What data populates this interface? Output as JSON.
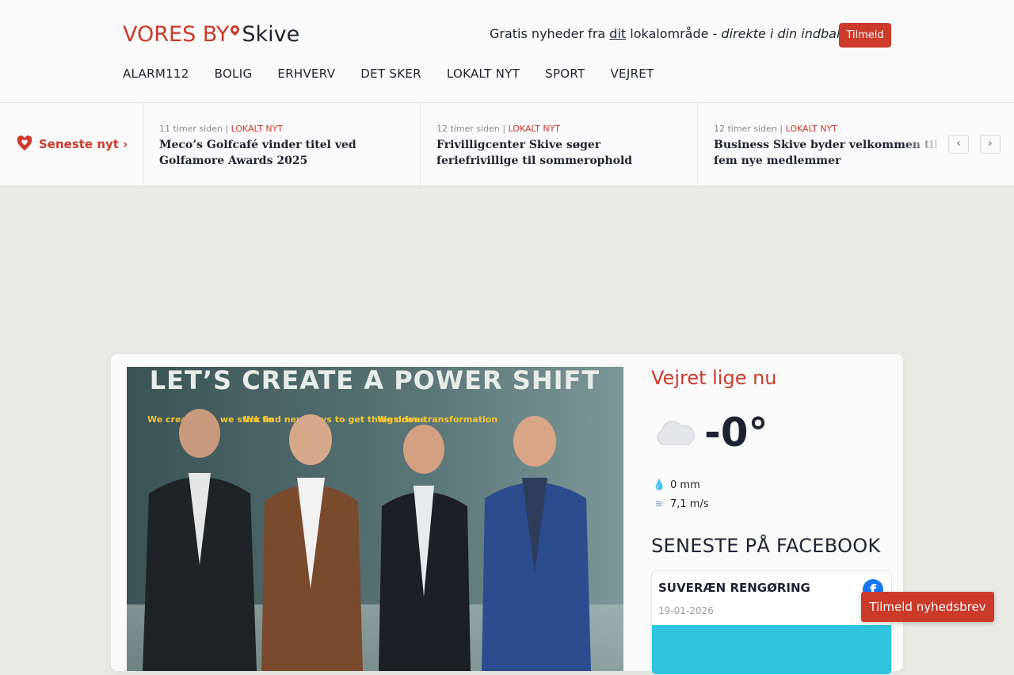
{
  "header": {
    "brand": "VORES BY",
    "city": "Skive",
    "tagline_prefix": "Gratis nyheder fra ",
    "tagline_dit": "dit",
    "tagline_mid": " lokalområde - ",
    "tagline_italic": "direkte i din indbakke",
    "subscribe_label": "Tilmeld"
  },
  "nav": [
    "ALARM112",
    "BOLIG",
    "ERHVERV",
    "DET SKER",
    "LOKALT NYT",
    "SPORT",
    "VEJRET"
  ],
  "ticker": {
    "label": "Seneste nyt ›",
    "prev": "‹",
    "next": "›",
    "stories": [
      {
        "time": "11 timer siden",
        "category": "LOKALT NYT",
        "headline": "Meco’s Golfcafé vinder titel ved Golfamore Awards 2025"
      },
      {
        "time": "12 timer siden",
        "category": "LOKALT NYT",
        "headline": "Frivilligcenter Skive søger feriefrivillige til sommerophold"
      },
      {
        "time": "12 timer siden",
        "category": "LOKALT NYT",
        "headline": "Business Skive byder velkommen til fem nye medlemmer"
      }
    ]
  },
  "hero": {
    "sign_text": "LET’S CREATE A POWER SHIFT",
    "col1": "We create tr... we stick to",
    "col2": "We find new ways to get things done",
    "col3": "We drive transformation"
  },
  "weather": {
    "title": "Vejret lige nu",
    "temperature": "-0°",
    "precipitation": "0 mm",
    "wind": "7,1 m/s"
  },
  "facebook": {
    "title": "SENESTE PÅ FACEBOOK",
    "post_title": "SUVERÆN RENGØRING",
    "post_date": "19-01-2026",
    "icon": "f"
  },
  "newsletter_button": "Tilmeld nyhedsbrev",
  "colors": {
    "accent": "#cc3a2a",
    "text": "#1e2233",
    "background": "#e9e9e6"
  }
}
